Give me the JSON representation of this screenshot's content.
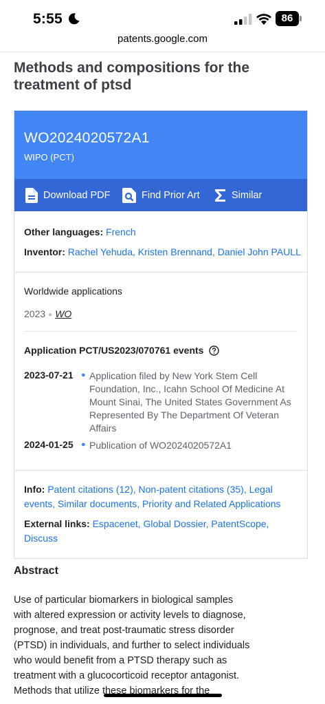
{
  "status": {
    "time": "5:55",
    "battery": "86"
  },
  "browser": {
    "url": "patents.google.com"
  },
  "page": {
    "title": "Methods and compositions for the treatment of ptsd"
  },
  "header": {
    "pub_number": "WO2024020572A1",
    "office": "WIPO (PCT)",
    "color": "#4285f4",
    "action_bar_color": "#3367d6"
  },
  "actions": {
    "download": "Download PDF",
    "prior_art": "Find Prior Art",
    "similar": "Similar"
  },
  "meta": {
    "other_languages_label": "Other languages:",
    "other_languages": [
      "French"
    ],
    "inventor_label": "Inventor:",
    "inventors": [
      "Rachel Yehuda",
      "Kristen Brennand",
      "Daniel John PAULL"
    ]
  },
  "worldwide": {
    "title": "Worldwide applications",
    "year": "2023",
    "country": "WO"
  },
  "events": {
    "title": "Application PCT/US2023/070761 events",
    "items": [
      {
        "date": "2023-07-21",
        "lines": [
          "Application filed by New York Stem Cell",
          "Foundation, Inc., Icahn School Of Medicine At",
          "Mount Sinai, The United States Government As",
          "Represented By The Department Of Veteran",
          "Affairs"
        ]
      },
      {
        "date": "2024-01-25",
        "lines": [
          "Publication of WO2024020572A1"
        ]
      }
    ]
  },
  "info": {
    "label": "Info:",
    "links": [
      "Patent citations (12)",
      "Non-patent citations (35)",
      "Legal events",
      "Similar documents",
      "Priority and Related Applications"
    ]
  },
  "external": {
    "label": "External links:",
    "links": [
      "Espacenet",
      "Global Dossier",
      "PatentScope",
      "Discuss"
    ]
  },
  "abstract": {
    "heading": "Abstract",
    "lines": [
      "Use of particular biomarkers in biological samples",
      "with altered expression or activity levels to diagnose,",
      "prognose, and treat post-traumatic stress disorder",
      "(PTSD) in individuals, and further to select individuals",
      "who would benefit from a PTSD therapy such as",
      "treatment with a glucocorticoid receptor antagonist.",
      "Methods that utilize these biomarkers for the"
    ]
  }
}
